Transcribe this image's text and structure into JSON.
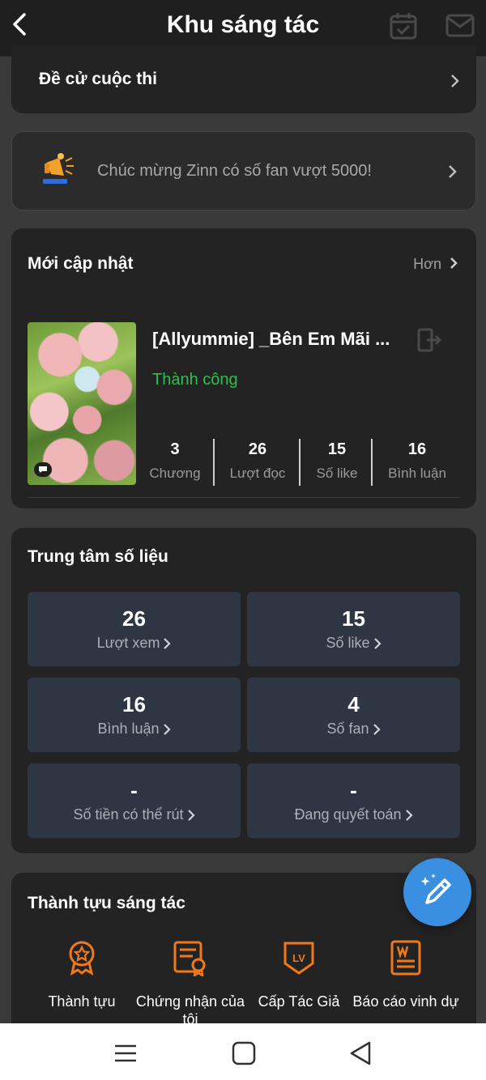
{
  "header": {
    "title": "Khu sáng tác"
  },
  "contest": {
    "label": "Đề cử cuộc thi"
  },
  "notice": {
    "message": "Chúc mừng Zinn có số fan vượt 5000!"
  },
  "recent": {
    "title": "Mới cập nhật",
    "more_label": "Hơn",
    "book": {
      "title": "[Allyummie] _Bên Em Mãi ...",
      "status": "Thành công",
      "stats": [
        {
          "value": "3",
          "label": "Chương"
        },
        {
          "value": "26",
          "label": "Lượt đọc"
        },
        {
          "value": "15",
          "label": "Số like"
        },
        {
          "value": "16",
          "label": "Bình luận"
        }
      ]
    }
  },
  "data_center": {
    "title": "Trung tâm số liệu",
    "tiles": [
      {
        "value": "26",
        "label": "Lượt xem"
      },
      {
        "value": "15",
        "label": "Số like"
      },
      {
        "value": "16",
        "label": "Bình luận"
      },
      {
        "value": "4",
        "label": "Số fan"
      },
      {
        "value": "-",
        "label": "Số tiền có thể rút"
      },
      {
        "value": "-",
        "label": "Đang quyết toán"
      }
    ]
  },
  "achievements": {
    "title": "Thành tựu sáng tác",
    "items": [
      {
        "label": "Thành tựu",
        "icon": "medal-icon"
      },
      {
        "label": "Chứng nhận của tôi",
        "icon": "certificate-icon"
      },
      {
        "label": "Cấp Tác Giả",
        "icon": "level-badge-icon"
      },
      {
        "label": "Báo cáo vinh dự",
        "icon": "honor-report-icon"
      }
    ]
  },
  "colors": {
    "accent_orange": "#f07a1a",
    "success_green": "#2fbf4f",
    "fab_blue": "#3b8fe0"
  }
}
